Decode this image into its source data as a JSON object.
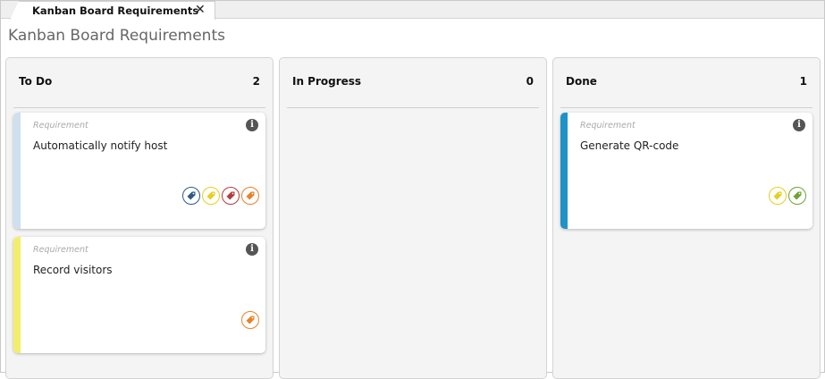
{
  "tab": {
    "label": "Kanban Board Requirements",
    "close": "✕"
  },
  "page": {
    "title": "Kanban Board Requirements"
  },
  "columns": [
    {
      "name": "To Do",
      "count": "2",
      "cards": [
        {
          "type": "Requirement",
          "title": "Automatically notify host",
          "stripe_color": "#cfe0ee",
          "tags": [
            "#2e5a88",
            "#e6cf1e",
            "#b43c3c",
            "#e8822a"
          ]
        },
        {
          "type": "Requirement",
          "title": "Record visitors",
          "stripe_color": "#f3ee6a",
          "tags": [
            "#e8822a"
          ]
        }
      ]
    },
    {
      "name": "In Progress",
      "count": "0",
      "cards": []
    },
    {
      "name": "Done",
      "count": "1",
      "cards": [
        {
          "type": "Requirement",
          "title": "Generate QR-code",
          "stripe_color": "#1f93c7",
          "tags": [
            "#e6cf1e",
            "#6da534"
          ]
        }
      ]
    }
  ],
  "icons": {
    "info": "info-icon",
    "tag": "tag-icon",
    "close": "close-icon"
  }
}
